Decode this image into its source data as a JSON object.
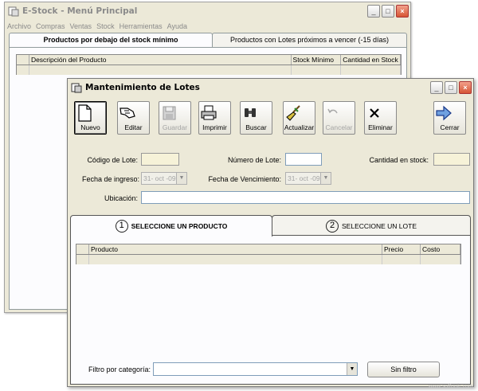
{
  "main_window": {
    "title": "E-Stock - Menú Principal",
    "menu": [
      "Archivo",
      "Compras",
      "Ventas",
      "Stock",
      "Herramientas",
      "Ayuda"
    ],
    "tabs": [
      "Productos por debajo del stock mínimo",
      "Productos con Lotes próximos a vencer (-15 días)"
    ],
    "columns": [
      "Descripción del Producto",
      "Stock Mínimo",
      "Cantidad en Stock"
    ]
  },
  "lote_window": {
    "title": "Mantenimiento de Lotes",
    "toolbar": {
      "nuevo": "Nuevo",
      "editar": "Editar",
      "guardar": "Guardar",
      "imprimir": "Imprimir",
      "buscar": "Buscar",
      "actualizar": "Actualizar",
      "cancelar": "Cancelar",
      "eliminar": "Eliminar",
      "cerrar": "Cerrar"
    },
    "form": {
      "codigo_label": "Código de Lote:",
      "codigo_value": "",
      "numero_label": "Número de Lote:",
      "numero_value": "",
      "cantidad_label": "Cantidad en stock:",
      "cantidad_value": "",
      "ingreso_label": "Fecha de ingreso:",
      "ingreso_value": "31- oct -09",
      "vencimiento_label": "Fecha de Vencimiento:",
      "vencimiento_value": "31- oct -09",
      "ubicacion_label": "Ubicación:",
      "ubicacion_value": ""
    },
    "tabs": [
      {
        "num": "1",
        "label": "SELECCIONE UN PRODUCTO"
      },
      {
        "num": "2",
        "label": "SELECCIONE UN LOTE"
      }
    ],
    "product_columns": [
      "Producto",
      "Precio",
      "Costo"
    ],
    "filter_label": "Filtro por categoría:",
    "filter_value": "",
    "sin_filtro": "Sin filtro"
  },
  "icons": {
    "window": "app-window-icon",
    "nuevo": "new-document-icon",
    "editar": "edit-hand-icon",
    "guardar": "floppy-disk-icon",
    "imprimir": "printer-icon",
    "buscar": "binoculars-icon",
    "actualizar": "broom-icon",
    "cancelar": "undo-arrow-icon",
    "eliminar": "delete-x-icon",
    "cerrar": "exit-arrow-icon"
  },
  "watermark": "www.softonic.com"
}
